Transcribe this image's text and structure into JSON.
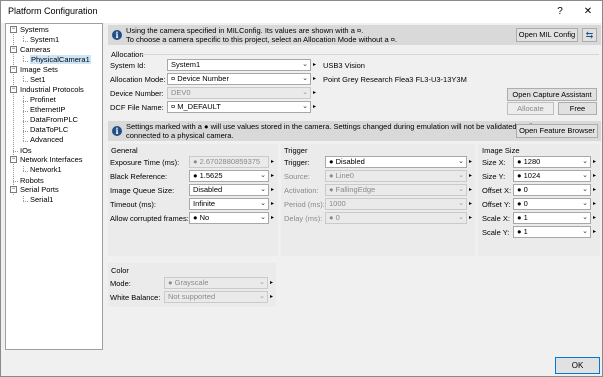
{
  "window": {
    "title": "Platform Configuration",
    "help_label": "?",
    "close_label": "✕"
  },
  "tree": [
    {
      "label": "Systems"
    },
    {
      "label": "System1"
    },
    {
      "label": "Cameras"
    },
    {
      "label": "PhysicalCamera1"
    },
    {
      "label": "Image Sets"
    },
    {
      "label": "Set1"
    },
    {
      "label": "Industrial Protocols"
    },
    {
      "label": "Profinet"
    },
    {
      "label": "EthernetIP"
    },
    {
      "label": "DataFromPLC"
    },
    {
      "label": "DataToPLC"
    },
    {
      "label": "Advanced"
    },
    {
      "label": "IOs"
    },
    {
      "label": "Network Interfaces"
    },
    {
      "label": "Network1"
    },
    {
      "label": "Robots"
    },
    {
      "label": "Serial Ports"
    },
    {
      "label": "Serial1"
    }
  ],
  "tree_toggle": "−",
  "info1": {
    "line1": "Using the camera specified in MILConfig.  Its values are shown with a ¤.",
    "line2": "To choose a camera specific to this project, select an Allocation Mode without a ¤.",
    "open_mil_label": "Open MIL Config",
    "refresh_icon": "⇆"
  },
  "allocation": {
    "group_label": "Allocation",
    "system_id_label": "System Id:",
    "system_id_value": "System1",
    "allocation_mode_label": "Allocation Mode:",
    "allocation_mode_value": "¤ Device Number",
    "device_number_label": "Device Number:",
    "device_number_value": "DEV0",
    "dcf_label": "DCF File Name:",
    "dcf_value": "¤ M_DEFAULT",
    "interface": "USB3 Vision",
    "camera_name": "Point Grey Research Flea3 FL3-U3-13Y3M",
    "capture_assistant_label": "Open Capture Assistant",
    "allocate_label": "Allocate",
    "free_label": "Free"
  },
  "info2": {
    "line1": "Settings marked with a ● will use values stored in the camera.  Settings changed during emulation will not be validated until",
    "line2": "connected to a physical camera.",
    "open_feature_label": "Open Feature Browser"
  },
  "general": {
    "group_label": "General",
    "exposure_label": "Exposure Time (ms):",
    "exposure_value": "● 2.6702880859375",
    "black_label": "Black Reference:",
    "black_value": "● 1.5625",
    "queue_label": "Image Queue Size:",
    "queue_value": "Disabled",
    "timeout_label": "Timeout (ms):",
    "timeout_value": "Infinite",
    "corrupt_label": "Allow corrupted frames:",
    "corrupt_value": "● No"
  },
  "trigger": {
    "group_label": "Trigger",
    "trigger_label": "Trigger:",
    "trigger_value": "● Disabled",
    "source_label": "Source:",
    "source_value": "● Line0",
    "activation_label": "Activation:",
    "activation_value": "● FallingEdge",
    "period_label": "Period (ms):",
    "period_value": "1000",
    "delay_label": "Delay (ms):",
    "delay_value": "● 0"
  },
  "image_size": {
    "group_label": "Image Size",
    "sizex_label": "Size X:",
    "sizex_value": "● 1280",
    "sizey_label": "Size Y:",
    "sizey_value": "● 1024",
    "offx_label": "Offset X:",
    "offx_value": "● 0",
    "offy_label": "Offset Y:",
    "offy_value": "● 0",
    "scalex_label": "Scale X:",
    "scalex_value": "● 1",
    "scaley_label": "Scale Y:",
    "scaley_value": "● 1"
  },
  "color": {
    "group_label": "Color",
    "mode_label": "Mode:",
    "mode_value": "● Grayscale",
    "wb_label": "White Balance:",
    "wb_value": "Not supported"
  },
  "footer": {
    "ok_label": "OK"
  },
  "glyphs": {
    "chevron": "⌄",
    "right_arrow": "▸"
  }
}
